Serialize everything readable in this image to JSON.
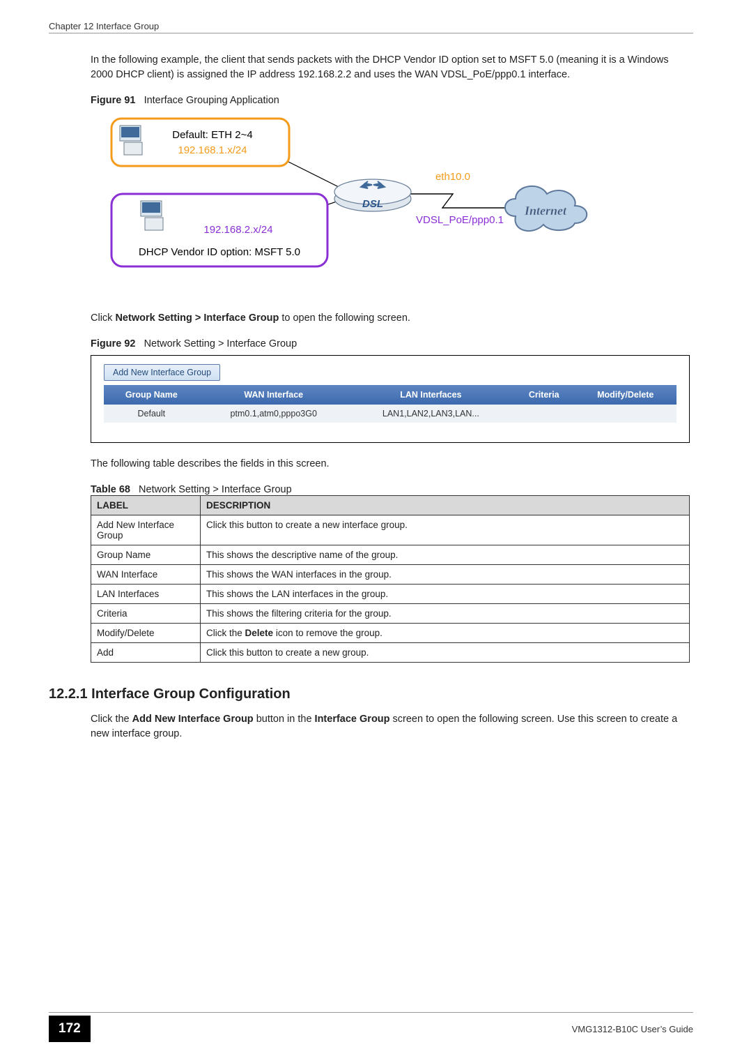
{
  "header": {
    "chapter": "Chapter 12 Interface Group"
  },
  "intro_paragraph": "In the following example, the client that sends packets with the DHCP Vendor ID option set to MSFT 5.0 (meaning it is a Windows 2000 DHCP client) is assigned the IP address 192.168.2.2 and uses the WAN VDSL_PoE/ppp0.1 interface.",
  "figure91": {
    "label": "Figure 91",
    "title": "Interface Grouping Application",
    "box1_line1": "Default: ETH 2~4",
    "box1_line2": "192.168.1.x/24",
    "box2_line1": "192.168.2.x/24",
    "box2_line2": "DHCP Vendor ID option: MSFT 5.0",
    "link_top": "eth10.0",
    "link_bottom": "VDSL_PoE/ppp0.1",
    "dsl_label": "DSL",
    "internet_label": "Internet"
  },
  "click_sentence": {
    "prefix": "Click ",
    "bold": "Network Setting > Interface Group",
    "suffix": " to open the following screen."
  },
  "figure92": {
    "label": "Figure 92",
    "title": "Network Setting > Interface Group"
  },
  "screenshot": {
    "add_button": "Add New Interface Group",
    "headers": [
      "Group Name",
      "WAN Interface",
      "LAN Interfaces",
      "Criteria",
      "Modify/Delete"
    ],
    "row": [
      "Default",
      "ptm0.1,atm0,pppo3G0",
      "LAN1,LAN2,LAN3,LAN...",
      "",
      ""
    ]
  },
  "table_intro": "The following table describes the fields in this screen.",
  "table68": {
    "label": "Table 68",
    "title": "Network Setting > Interface Group",
    "headers": [
      "LABEL",
      "DESCRIPTION"
    ],
    "rows": [
      [
        "Add New Interface Group",
        "Click this button to create a new interface group."
      ],
      [
        "Group Name",
        "This shows the descriptive name of the group."
      ],
      [
        "WAN Interface",
        "This shows the WAN interfaces in the group."
      ],
      [
        "LAN Interfaces",
        "This shows the LAN interfaces in the group."
      ],
      [
        "Criteria",
        "This shows the filtering criteria for the group."
      ],
      [
        "Modify/Delete",
        {
          "prefix": "Click the ",
          "bold": "Delete",
          "suffix": " icon to remove the group."
        }
      ],
      [
        "Add",
        "Click this button to create a new group."
      ]
    ]
  },
  "section_12_2_1": {
    "heading": "12.2.1  Interface Group Configuration",
    "para": {
      "prefix": "Click the ",
      "bold1": "Add New Interface Group",
      "mid": " button in the ",
      "bold2": "Interface Group",
      "suffix": " screen to open the following screen. Use this screen to create a new interface group."
    }
  },
  "footer": {
    "page": "172",
    "guide": "VMG1312-B10C User’s Guide"
  }
}
